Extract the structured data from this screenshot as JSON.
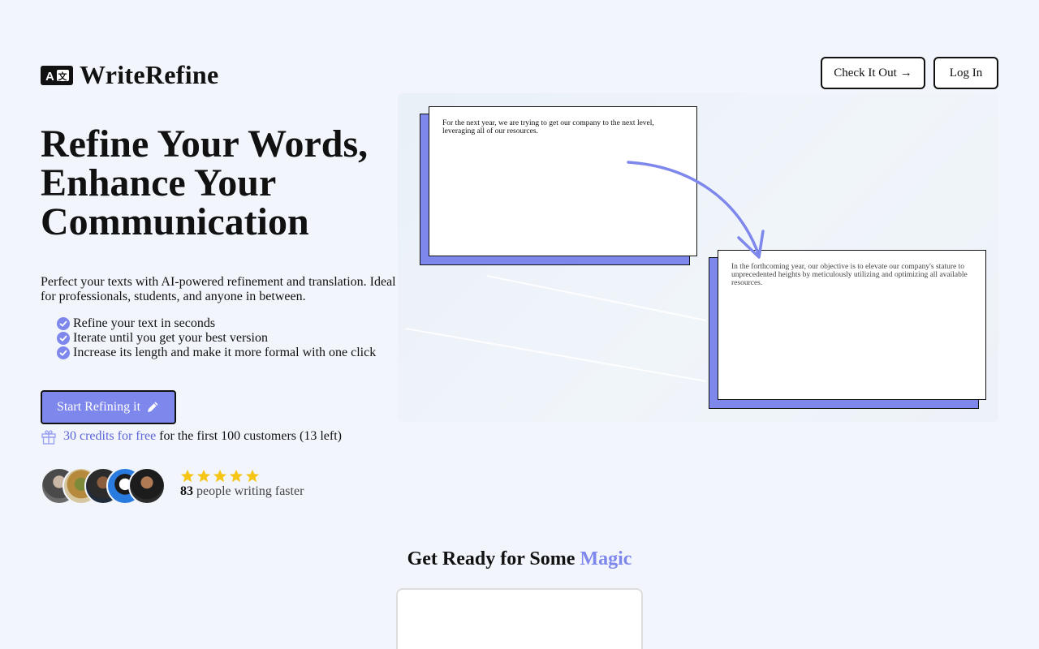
{
  "brand": {
    "name": "WriteRefine",
    "logo_icon": "translate-icon"
  },
  "nav": {
    "check_label": "Check It Out",
    "check_arrow": "→",
    "login_label": "Log In"
  },
  "hero": {
    "title": "Refine Your Words, Enhance Your Communication",
    "description": "Perfect your texts with AI-powered refinement and translation. Ideal for professionals, students, and anyone in between.",
    "features": [
      "Refine your text in seconds",
      "Iterate until you get your best version",
      "Increase its length and make it more formal with one click"
    ],
    "cta_label": "Start Refining it",
    "credits_highlight": "30 credits for free",
    "credits_rest": "for the first 100 customers (13 left)"
  },
  "social_proof": {
    "star_count": 5,
    "count": "83",
    "text": "people writing faster"
  },
  "demo": {
    "input_text": "For the next year, we are trying to get our company to the next level, leveraging all of our resources.",
    "output_text": "In the forthcoming year, our objective is to elevate our company's stature to unprecedented heights by meticulously utilizing and optimizing all available resources."
  },
  "magic": {
    "title_prefix": "Get Ready for Some",
    "title_highlight": "Magic"
  },
  "colors": {
    "accent": "#7e87ec",
    "background": "#f2f6fc",
    "star": "#f5c518",
    "link": "#5b63d6"
  }
}
